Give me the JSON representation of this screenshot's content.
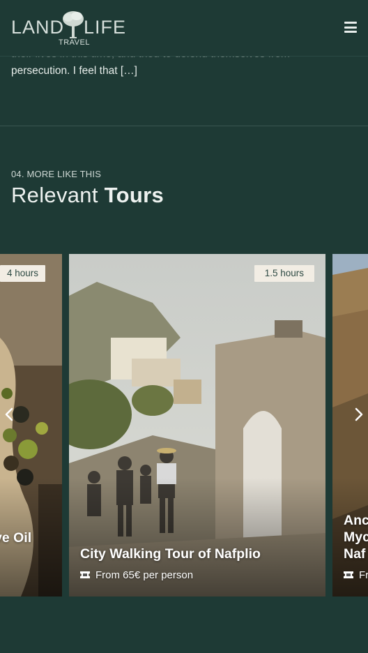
{
  "header": {
    "logo_left": "LAND",
    "logo_right": "LIFE",
    "logo_sub": "TRAVEL",
    "menu_icon": "hamburger-menu-icon"
  },
  "intro": {
    "line1": "their lives in this time, and tried to defend themselves from",
    "line2": "persecution. I feel that […]"
  },
  "section": {
    "kicker": "04. MORE LIKE THIS",
    "title_light": "Relevant",
    "title_bold": "Tours"
  },
  "carousel": {
    "prev_icon": "chevron-left-icon",
    "next_icon": "chevron-right-icon",
    "cards": [
      {
        "duration": "4 hours",
        "title": "Olive Oil",
        "image": "olives-photo"
      },
      {
        "duration": "1.5 hours",
        "title": "City Walking Tour of Nafplio",
        "price": "From 65€ per person",
        "image": "nafplio-gate-photo"
      },
      {
        "title_line1": "Anc",
        "title_line2": "Myc",
        "title_line3": "Naf",
        "price": "Fr",
        "image": "mycenae-ruins-photo"
      }
    ]
  },
  "colors": {
    "background": "#1e3a35",
    "badge_bg": "#f2ede4",
    "badge_text": "#2e4a44"
  }
}
